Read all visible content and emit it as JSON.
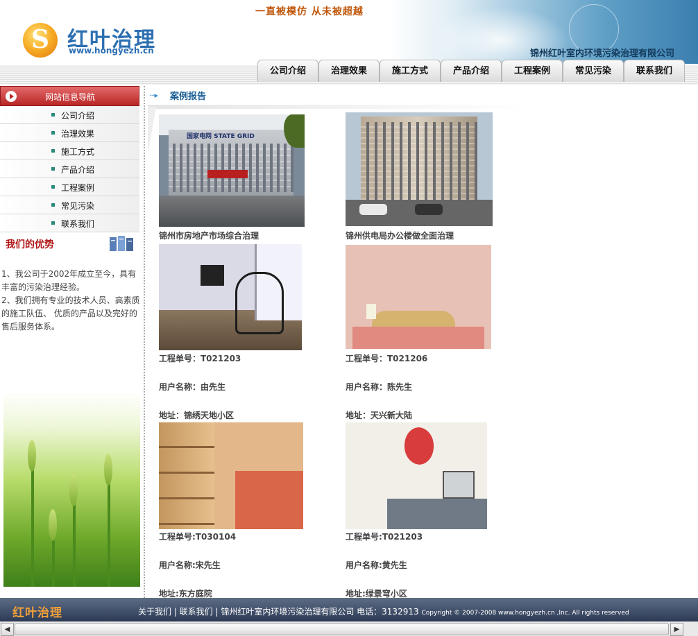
{
  "header": {
    "slogan": "一直被模仿  从未被超越",
    "logo_text": "红叶治理",
    "logo_url": "www.hongyezh.cn",
    "company_name": "锦州红叶室内环境污染治理有限公司",
    "nav": [
      "公司介绍",
      "治理效果",
      "施工方式",
      "产品介绍",
      "工程案例",
      "常见污染",
      "联系我们"
    ]
  },
  "sidebar": {
    "nav_title": "网站信息导航",
    "menu": [
      "公司介绍",
      "治理效果",
      "施工方式",
      "产品介绍",
      "工程案例",
      "常见污染",
      "联系我们"
    ],
    "advantages_title": "我们的优势",
    "advantages_text": [
      "1、我公司于2002年成立至今，具有丰富的污染治理经验。",
      "2、我们拥有专业的技术人员、高素质的施工队伍、 优质的产品以及完好的售后服务体系。"
    ]
  },
  "main": {
    "section_title": "案例报告",
    "cases": [
      {
        "caption": "锦州市房地产市场综合治理"
      },
      {
        "caption": "锦州供电局办公楼做全面治理"
      },
      {
        "project": "工程单号：T021203",
        "user": "用户名称：由先生",
        "address": "地址：锦绣天地小区"
      },
      {
        "project": "工程单号：T021206",
        "user": "用户名称：陈先生",
        "address": "地址：天兴新大陆"
      },
      {
        "project": "工程单号:T030104",
        "user": "用户名称:宋先生",
        "address": "地址:东方庭院"
      },
      {
        "project": "工程单号:T021203",
        "user": "用户名称:黄先生",
        "address": "地址:绿景穹小区"
      }
    ]
  },
  "footer": {
    "logo": "红叶治理",
    "links_text": "关于我们 | 联系我们 | 锦州红叶室内环境污染治理有限公司 电话：3132913",
    "copyright": "Copyright © 2007-2008 www.hongyezh.cn ,Inc. All rights reserved"
  },
  "colors": {
    "brand_blue": "#2c6fb1",
    "brand_red": "#b92626",
    "footer_bg": "#2c3a55",
    "slogan": "#c0560a"
  }
}
